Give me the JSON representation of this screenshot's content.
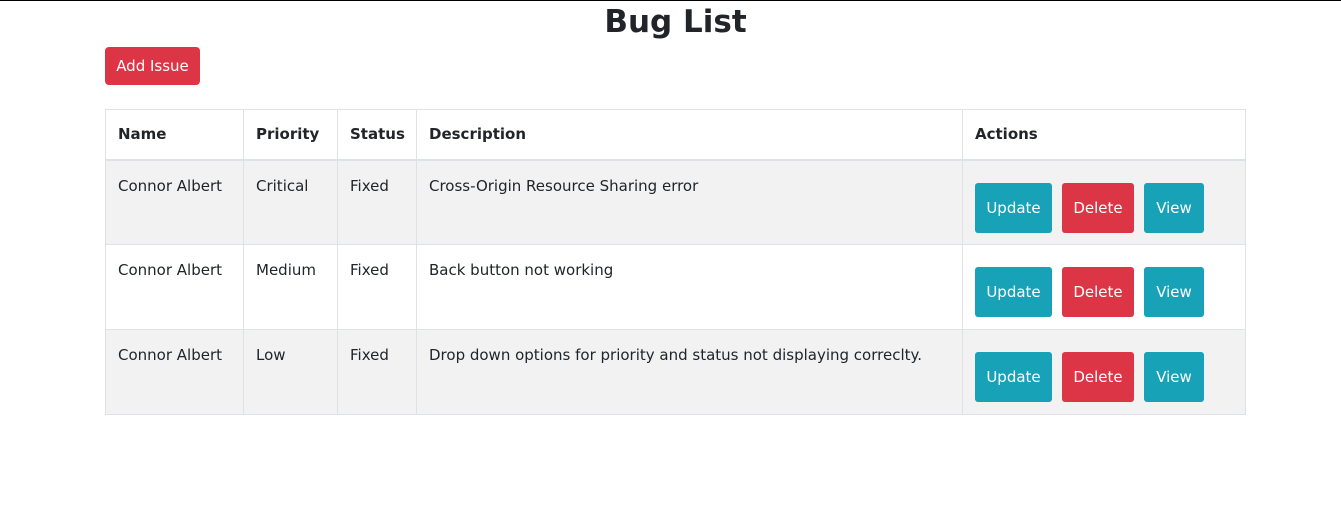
{
  "page": {
    "title": "Bug List",
    "add_button_label": "Add Issue"
  },
  "table": {
    "headers": {
      "name": "Name",
      "priority": "Priority",
      "status": "Status",
      "description": "Description",
      "actions": "Actions"
    },
    "rows": [
      {
        "name": "Connor Albert",
        "priority": "Critical",
        "status": "Fixed",
        "description": "Cross-Origin Resource Sharing error",
        "update_label": "Update",
        "delete_label": "Delete",
        "view_label": "View"
      },
      {
        "name": "Connor Albert",
        "priority": "Medium",
        "status": "Fixed",
        "description": "Back button not working",
        "update_label": "Update",
        "delete_label": "Delete",
        "view_label": "View"
      },
      {
        "name": "Connor Albert",
        "priority": "Low",
        "status": "Fixed",
        "description": "Drop down options for priority and status not displaying correclty.",
        "update_label": "Update",
        "delete_label": "Delete",
        "view_label": "View"
      }
    ]
  },
  "colors": {
    "danger": "#dc3545",
    "info": "#17a2b8",
    "stripe": "#f2f2f2",
    "border": "#dee2e6"
  }
}
